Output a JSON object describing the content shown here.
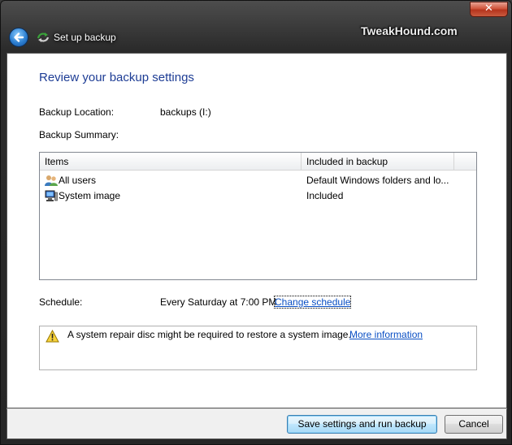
{
  "window": {
    "title": "Set up backup",
    "close_label": "✕",
    "watermark": "TweakHound.com"
  },
  "content": {
    "heading": "Review your backup settings",
    "location_label": "Backup Location:",
    "location_value": "backups (I:)",
    "summary_label": "Backup Summary:",
    "table": {
      "columns": [
        "Items",
        "Included in backup"
      ],
      "rows": [
        {
          "icon": "users-icon",
          "item": "All users",
          "included": "Default Windows folders and lo..."
        },
        {
          "icon": "computer-icon",
          "item": "System image",
          "included": "Included"
        }
      ]
    },
    "schedule_label": "Schedule:",
    "schedule_value": "Every Saturday at 7:00 PM",
    "change_schedule_link": "Change schedule",
    "warning_icon": "warning-icon",
    "warning_text": "A system repair disc might be required to restore a system image.",
    "more_info_link": "More information"
  },
  "footer": {
    "save_button": "Save settings and run backup",
    "cancel_button": "Cancel"
  },
  "colors": {
    "heading": "#1e3d95",
    "link": "#0a4fc4",
    "chrome": "#2b2b2b",
    "close_button": "#c95a3f"
  }
}
